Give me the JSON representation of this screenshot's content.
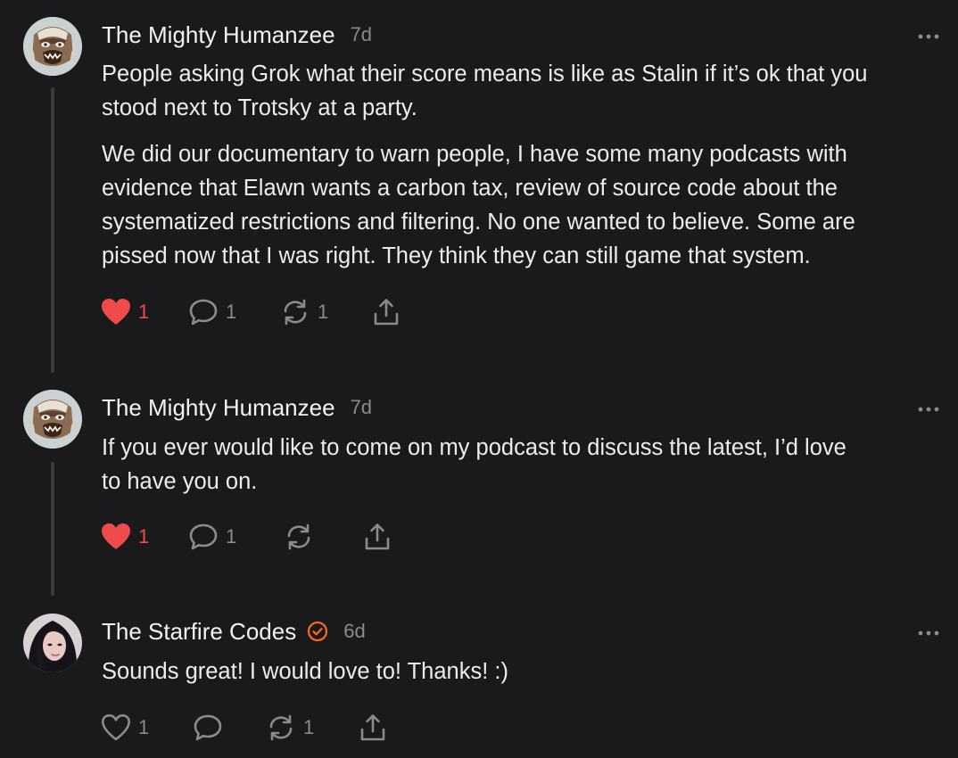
{
  "comments": [
    {
      "author": "The Mighty Humanzee",
      "time": "7d",
      "verified": false,
      "paragraphs": [
        "People asking Grok what their score means is like as Stalin if it’s ok that you",
        "stood next to Trotsky at a party.",
        "We did our documentary to warn people, I have some many podcasts with",
        "evidence that Elawn wants a carbon tax, review of source code about the",
        "systematized restrictions and filtering. No one wanted to believe. Some are",
        "pissed now that I was right. They think they can still game that system."
      ],
      "likes": "1",
      "liked": true,
      "replies": "1",
      "restacks": "1"
    },
    {
      "author": "The Mighty Humanzee",
      "time": "7d",
      "verified": false,
      "paragraphs": [
        "If you ever would like to come on my podcast to discuss the latest, I’d love",
        "to have you on."
      ],
      "likes": "1",
      "liked": true,
      "replies": "1",
      "restacks": ""
    },
    {
      "author": "The Starfire Codes",
      "time": "6d",
      "verified": true,
      "paragraphs": [
        "Sounds great! I would love to! Thanks! :)"
      ],
      "likes": "1",
      "liked": false,
      "replies": "",
      "restacks": "1"
    }
  ],
  "icons": {
    "avatar_1": "ape-mask-avatar",
    "avatar_2": "woman-portrait-avatar",
    "like": "heart-icon",
    "reply": "speech-bubble-icon",
    "restack": "restack-arrows-icon",
    "share": "share-icon",
    "more": "more-dots-icon",
    "verified": "verified-check-icon"
  },
  "colors": {
    "background": "#1a1a1c",
    "text": "#ececec",
    "muted": "#8b8b8f",
    "like_active": "#ef4b4b",
    "verified": "#ff6719",
    "thread_line": "#3a3a3d"
  }
}
